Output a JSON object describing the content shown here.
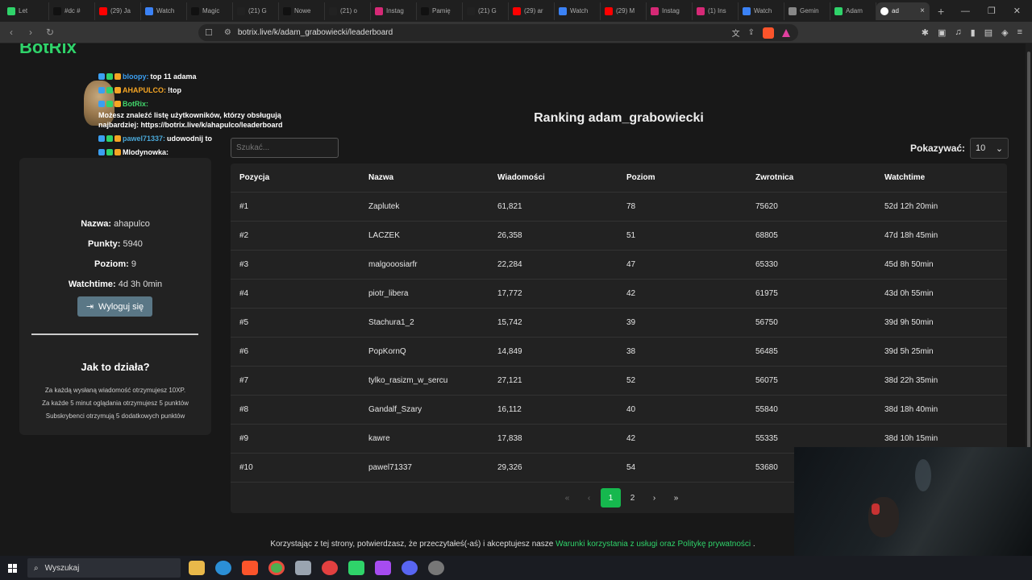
{
  "browser": {
    "tabs": [
      {
        "label": "Let",
        "color": "#2fd36a"
      },
      {
        "label": "#dc #",
        "color": "#111111"
      },
      {
        "label": "(29) Ja",
        "color": "#ff0000"
      },
      {
        "label": "Watch",
        "color": "#3b82f6"
      },
      {
        "label": "Magic",
        "color": "#111111"
      },
      {
        "label": "(21) G",
        "color": "#222222"
      },
      {
        "label": "Nowe",
        "color": "#111111"
      },
      {
        "label": "(21) o",
        "color": "#222222"
      },
      {
        "label": "Instag",
        "color": "#d62976"
      },
      {
        "label": "Pamię",
        "color": "#111111"
      },
      {
        "label": "(21) G",
        "color": "#222222"
      },
      {
        "label": "(29) ar",
        "color": "#ff0000"
      },
      {
        "label": "Watch",
        "color": "#3b82f6"
      },
      {
        "label": "(29) M",
        "color": "#ff0000"
      },
      {
        "label": "Instag",
        "color": "#d62976"
      },
      {
        "label": "(1) Ins",
        "color": "#d62976"
      },
      {
        "label": "Watch",
        "color": "#3b82f6"
      },
      {
        "label": "Gemin",
        "color": "#888888"
      },
      {
        "label": "Adam",
        "color": "#2fd36a"
      }
    ],
    "active_tab": {
      "label": "ad",
      "close": "×"
    },
    "new_tab": "+",
    "url": "botrix.live/k/adam_grabowiecki/leaderboard"
  },
  "page": {
    "logo": "BotRix",
    "chat": [
      {
        "user": "bloopy:",
        "user_class": "u-blue",
        "msg": "top 11 adama"
      },
      {
        "user": "AHAPULCO:",
        "user_class": "u-orange",
        "msg": "!top"
      },
      {
        "user": "BotRix:",
        "user_class": "u-green",
        "msg": "Możesz znaleźć listę użytkowników, którzy obsługują najbardziej: https://botrix.live/k/ahapulco/leaderboard"
      },
      {
        "user": "pawel71337:",
        "user_class": "u-teal",
        "msg": "udowodnij to"
      },
      {
        "user": "",
        "user_class": "",
        "msg": "Mlodynowka:"
      },
      {
        "user": "bloopy:",
        "user_class": "u-blue",
        "msg": ""
      }
    ],
    "profile": {
      "name_label": "Nazwa:",
      "name": "ahapulco",
      "points_label": "Punkty:",
      "points": "5940",
      "level_label": "Poziom:",
      "level": "9",
      "watchtime_label": "Watchtime:",
      "watchtime": "4d 3h 0min",
      "logout": "Wyloguj się"
    },
    "how": {
      "title": "Jak to działa?",
      "lines": [
        "Za każdą wysłaną wiadomość otrzymujesz 10XP.",
        "Za każde 5 minut oglądania otrzymujesz 5 punktów",
        "Subskrybenci otrzymują 5 dodatkowych punktów"
      ]
    },
    "ranking_title": "Ranking adam_grabowiecki",
    "search_placeholder": "Szukać...",
    "show_label": "Pokazywać:",
    "show_value": "10",
    "columns": [
      "Pozycja",
      "Nazwa",
      "Wiadomości",
      "Poziom",
      "Zwrotnica",
      "Watchtime"
    ],
    "rows": [
      [
        "#1",
        "Zaplutek",
        "61,821",
        "78",
        "75620",
        "52d 12h 20min"
      ],
      [
        "#2",
        "LACZEK",
        "26,358",
        "51",
        "68805",
        "47d 18h 45min"
      ],
      [
        "#3",
        "malgooosiarfr",
        "22,284",
        "47",
        "65330",
        "45d 8h 50min"
      ],
      [
        "#4",
        "piotr_libera",
        "17,772",
        "42",
        "61975",
        "43d 0h 55min"
      ],
      [
        "#5",
        "Stachura1_2",
        "15,742",
        "39",
        "56750",
        "39d 9h 50min"
      ],
      [
        "#6",
        "PopKornQ",
        "14,849",
        "38",
        "56485",
        "39d 5h 25min"
      ],
      [
        "#7",
        "tylko_rasizm_w_sercu",
        "27,121",
        "52",
        "56075",
        "38d 22h 35min"
      ],
      [
        "#8",
        "Gandalf_Szary",
        "16,112",
        "40",
        "55840",
        "38d 18h 40min"
      ],
      [
        "#9",
        "kawre",
        "17,838",
        "42",
        "55335",
        "38d 10h 15min"
      ],
      [
        "#10",
        "pawel71337",
        "29,326",
        "54",
        "53680",
        ""
      ]
    ],
    "pager": {
      "first": "«",
      "prev": "‹",
      "current": "1",
      "next_page": "2",
      "next": "›",
      "last": "»"
    },
    "footer": {
      "text": "Korzystając z tej strony, potwierdzasz, że przeczytałeś(-aś) i akceptujesz nasze",
      "link": "Warunki korzystania z usługi oraz Politykę prywatności",
      "end": "."
    }
  },
  "taskbar": {
    "search": "Wyszukaj"
  }
}
